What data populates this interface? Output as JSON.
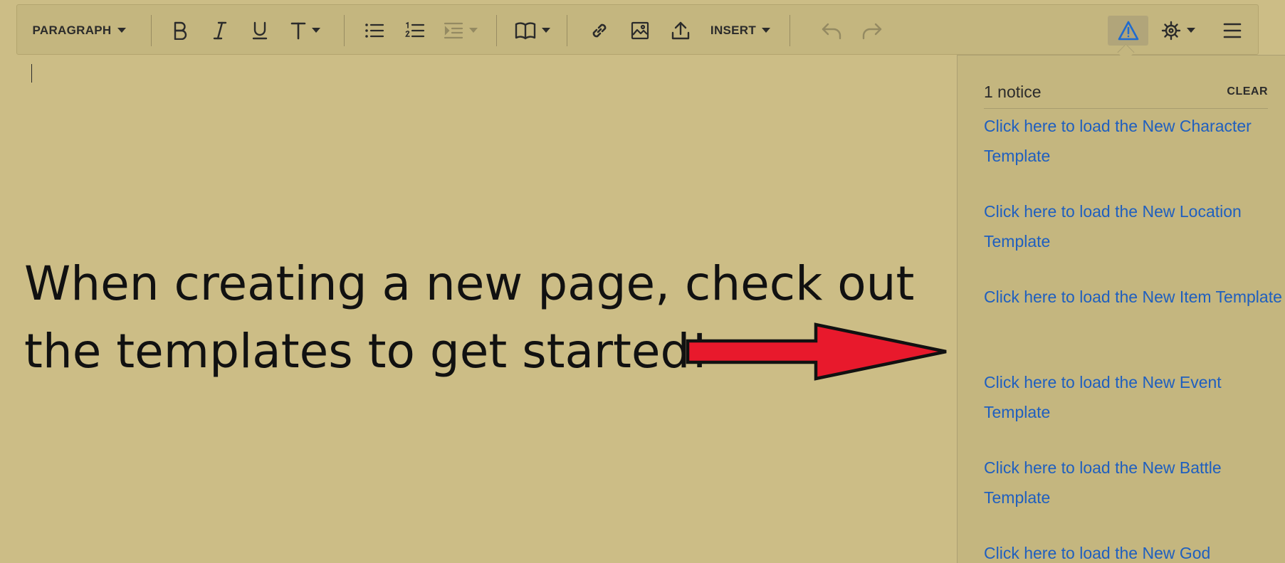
{
  "toolbar": {
    "paragraph_label": "PARAGRAPH",
    "insert_label": "INSERT"
  },
  "icons": {
    "bold": "bold-icon",
    "italic": "italic-icon",
    "underline": "underline-icon",
    "text_size": "text-size-icon",
    "bullet_list": "bullet-list-icon",
    "numbered_list": "numbered-list-icon",
    "indent": "indent-icon",
    "book": "book-icon",
    "link": "link-icon",
    "image": "image-icon",
    "upload": "upload-icon",
    "undo": "undo-icon",
    "redo": "redo-icon",
    "warning": "warning-icon",
    "settings": "gear-icon",
    "menu": "hamburger-menu-icon"
  },
  "colors": {
    "page_background": "#ccbd86",
    "toolbar_background": "#c4b67f",
    "link": "#1f5fbf",
    "warning_icon": "#1f6bd0",
    "arrow_fill": "#e8192c"
  },
  "editor": {
    "content": "When creating a new page, check out the templates to get started!"
  },
  "notices": {
    "count_label": "1 notice",
    "clear_label": "CLEAR",
    "links": [
      "Click here to load the New Character Template",
      "Click here to load the New Location Template",
      "Click here to load the New Item Template",
      "Click here to load the New Event Template",
      "Click here to load the New Battle Template",
      "Click here to load the New God"
    ]
  }
}
